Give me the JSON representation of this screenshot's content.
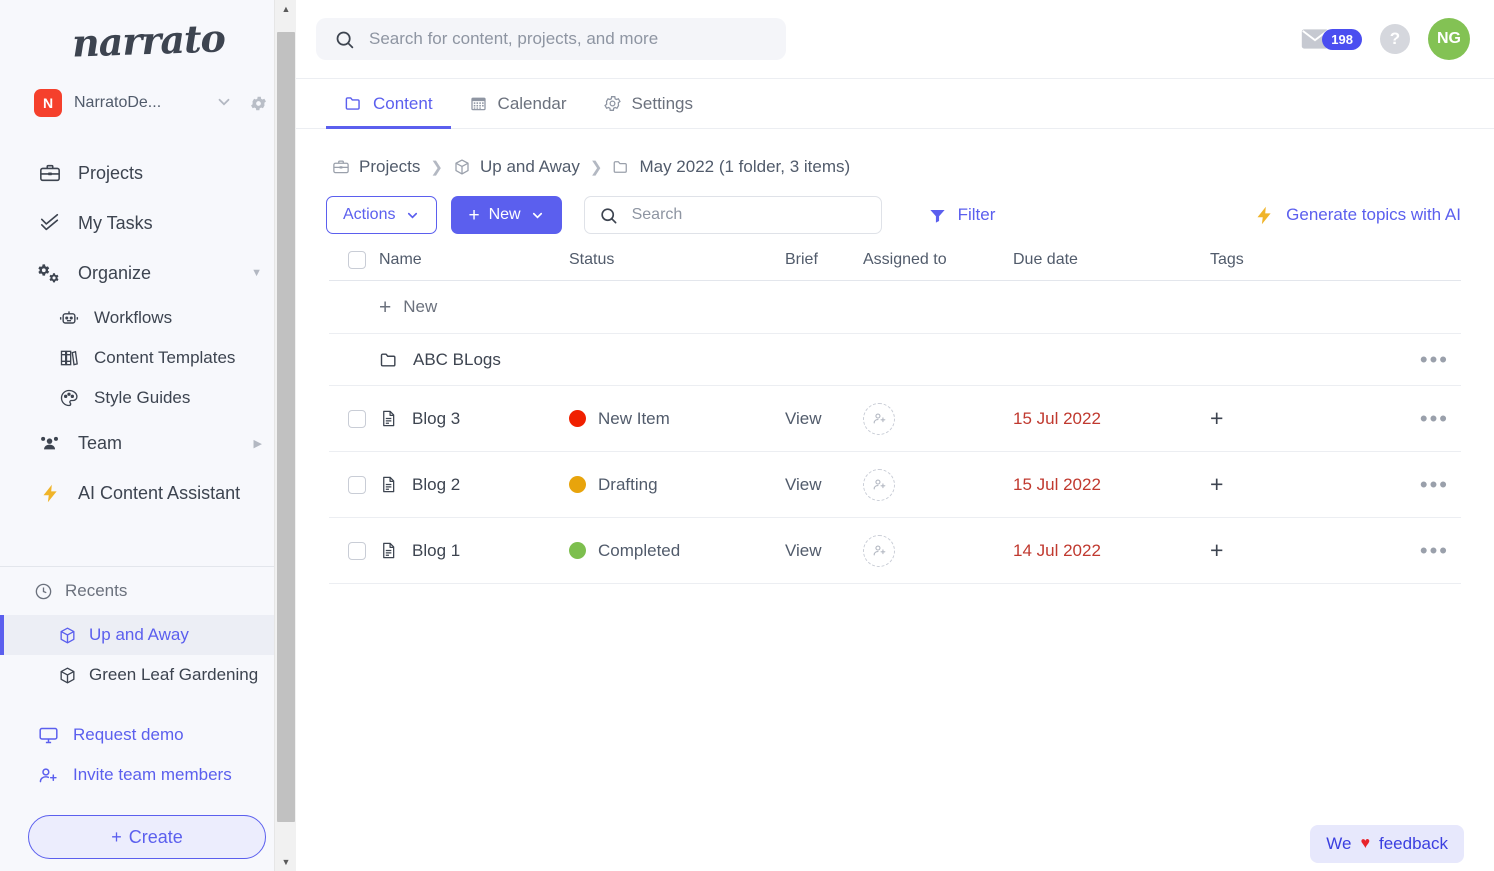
{
  "sidebar": {
    "logo_text": "narrato",
    "workspace": {
      "avatar_initial": "N",
      "name": "NarratoDe..."
    },
    "nav": [
      {
        "label": "Projects",
        "icon": "briefcase-icon"
      },
      {
        "label": "My Tasks",
        "icon": "check-list-icon"
      },
      {
        "label": "Organize",
        "icon": "gears-icon",
        "caret": "▼"
      }
    ],
    "organize_children": [
      {
        "label": "Workflows",
        "icon": "robot-icon"
      },
      {
        "label": "Content Templates",
        "icon": "books-icon"
      },
      {
        "label": "Style Guides",
        "icon": "palette-icon"
      }
    ],
    "team": {
      "label": "Team",
      "icon": "people-icon",
      "caret": "▶"
    },
    "ai_assistant": {
      "label": "AI Content Assistant",
      "icon": "bolt-icon"
    },
    "recents_label": "Recents",
    "recents": [
      {
        "label": "Up and Away",
        "icon": "cube-icon",
        "active": true
      },
      {
        "label": "Green Leaf Gardening",
        "icon": "cube-icon",
        "active": false
      }
    ],
    "links": [
      {
        "label": "Request demo",
        "icon": "monitor-icon"
      },
      {
        "label": "Invite team members",
        "icon": "user-plus-icon"
      }
    ],
    "create_label": "Create"
  },
  "topbar": {
    "search_placeholder": "Search for content, projects, and more",
    "mail_badge": "198",
    "help_label": "?",
    "avatar_initials": "NG"
  },
  "tabs": [
    {
      "label": "Content",
      "icon": "folder-icon",
      "active": true
    },
    {
      "label": "Calendar",
      "icon": "calendar-icon",
      "active": false
    },
    {
      "label": "Settings",
      "icon": "gear-icon",
      "active": false
    }
  ],
  "breadcrumb": [
    {
      "label": "Projects",
      "icon": "briefcase-icon"
    },
    {
      "label": "Up and Away",
      "icon": "cube-icon"
    },
    {
      "label": "May 2022 (1 folder, 3 items)",
      "icon": "folder-icon"
    }
  ],
  "toolbar": {
    "actions_label": "Actions",
    "new_label": "New",
    "search_placeholder": "Search",
    "filter_label": "Filter",
    "ai_label": "Generate topics with AI"
  },
  "table": {
    "columns": [
      "Name",
      "Status",
      "Brief",
      "Assigned to",
      "Due date",
      "Tags"
    ],
    "new_row_label": "New",
    "folder_row": {
      "name": "ABC BLogs",
      "icon": "folder-icon"
    },
    "rows": [
      {
        "name": "Blog 3",
        "status": "New Item",
        "status_color": "#f02000",
        "brief": "View",
        "due": "15 Jul 2022"
      },
      {
        "name": "Blog 2",
        "status": "Drafting",
        "status_color": "#e8a40c",
        "brief": "View",
        "due": "15 Jul 2022"
      },
      {
        "name": "Blog 1",
        "status": "Completed",
        "status_color": "#7dbf4e",
        "brief": "View",
        "due": "14 Jul 2022"
      }
    ]
  },
  "feedback": {
    "prefix": "We",
    "heart": "♥",
    "suffix": "feedback"
  },
  "colors": {
    "accent": "#5b5fee",
    "due_red": "#c0392f",
    "brand_red": "#f5402c",
    "avatar_green": "#83c254"
  }
}
